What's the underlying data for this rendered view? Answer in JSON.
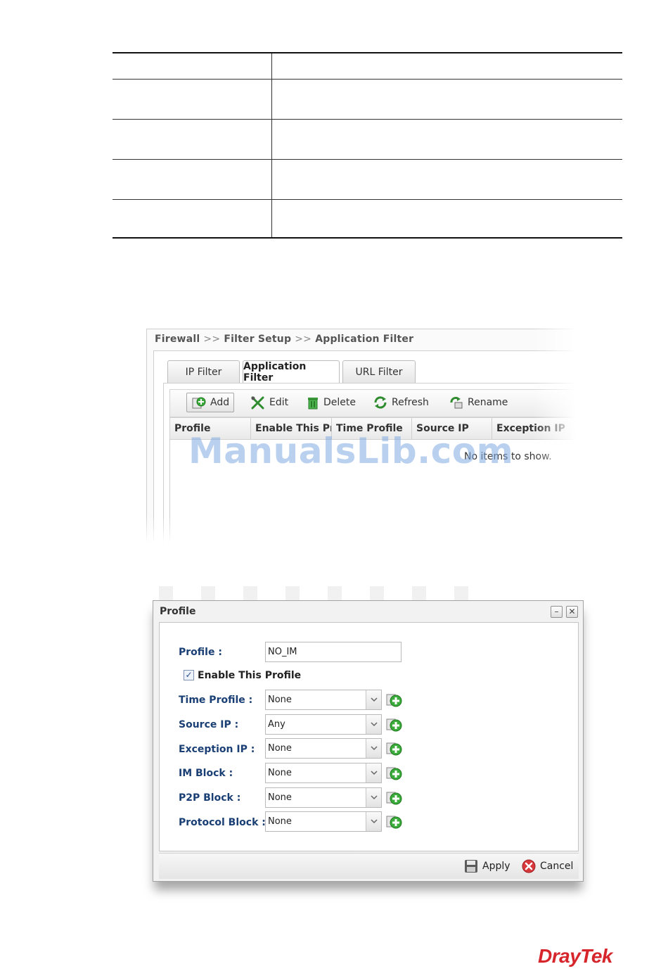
{
  "app_window": {
    "breadcrumb": [
      "Firewall",
      "Filter Setup",
      "Application Filter"
    ],
    "breadcrumb_sep": ">>",
    "tabs": [
      {
        "label": "IP Filter",
        "active": false
      },
      {
        "label": "Application Filter",
        "active": true
      },
      {
        "label": "URL Filter",
        "active": false
      }
    ],
    "toolbar": {
      "add": "Add",
      "edit": "Edit",
      "delete": "Delete",
      "refresh": "Refresh",
      "rename": "Rename"
    },
    "columns": [
      "Profile",
      "Enable This Pro",
      "Time Profile",
      "Source IP",
      "Exception IP"
    ],
    "empty_message": "No items to show."
  },
  "watermark": "ManualsLib.com",
  "profile_dialog": {
    "title": "Profile",
    "profile_label": "Profile :",
    "profile_value": "NO_IM",
    "enable_label": "Enable This Profile",
    "enable_checked": "✓",
    "fields": [
      {
        "label": "Time Profile :",
        "value": "None"
      },
      {
        "label": "Source IP :",
        "value": "Any"
      },
      {
        "label": "Exception IP :",
        "value": "None"
      },
      {
        "label": "IM Block :",
        "value": "None"
      },
      {
        "label": "P2P Block :",
        "value": "None"
      },
      {
        "label": "Protocol Block :",
        "value": "None"
      }
    ],
    "apply": "Apply",
    "cancel": "Cancel",
    "minimize_glyph": "–",
    "close_glyph": "✕"
  },
  "logo": "DrayTek",
  "colors": {
    "label_blue": "#1a3f74",
    "logo_red": "#d6262b",
    "add_green": "#3bab3b"
  }
}
